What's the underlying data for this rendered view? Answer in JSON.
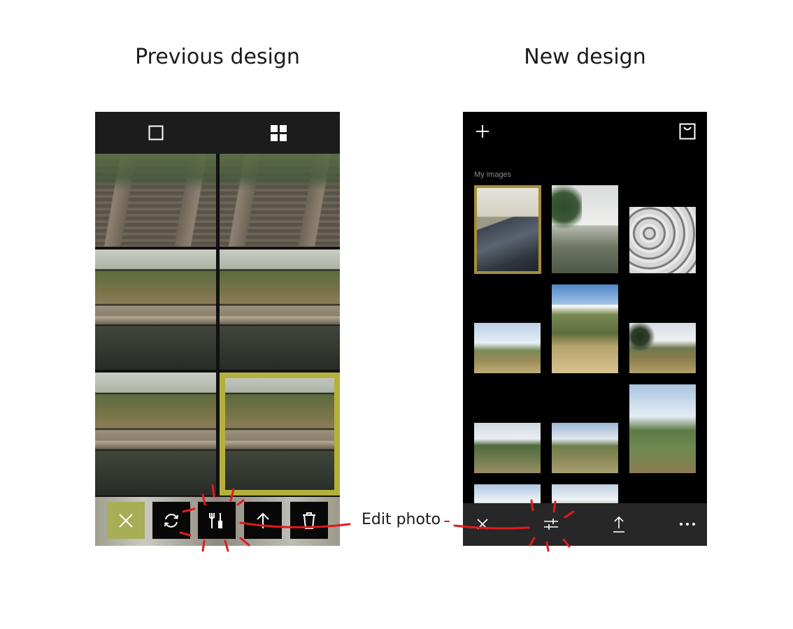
{
  "headings": {
    "previous": "Previous design",
    "new": "New design"
  },
  "previous_design": {
    "top_bar": {
      "single_view_icon": "square-icon",
      "grid_view_icon": "grid-icon"
    },
    "toolbar": {
      "close_icon": "close-icon",
      "rotate_icon": "rotate-icon",
      "edit_icon": "edit-tools-icon",
      "share_icon": "arrow-up-icon",
      "delete_icon": "trash-icon",
      "close_button_color": "#a7ae55"
    },
    "selection_color": "#b4b03e"
  },
  "new_design": {
    "top_bar": {
      "add_icon": "plus-icon",
      "cart_icon": "bag-icon"
    },
    "section_title": "My images",
    "toolbar": {
      "close_icon": "close-icon",
      "edit_icon": "sliders-icon",
      "share_icon": "upload-icon",
      "more_icon": "more-icon"
    },
    "selection_color": "#a68d3c"
  },
  "annotation": {
    "label": "Edit photo",
    "color": "#e11a1a"
  }
}
